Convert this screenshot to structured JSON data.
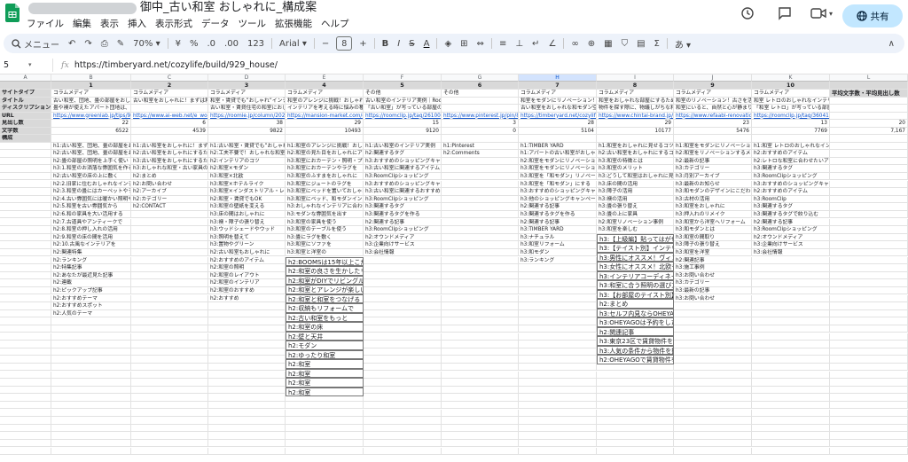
{
  "app": {
    "doc_title": "御中_古い和室 おしゃれに_構成案",
    "share_label": "共有",
    "colors": {
      "accent": "#0b57d0",
      "sheets_green": "#0f9d58",
      "share_bg": "#c2e7ff"
    }
  },
  "menu": [
    "ファイル",
    "編集",
    "表示",
    "挿入",
    "表示形式",
    "データ",
    "ツール",
    "拡張機能",
    "ヘルプ"
  ],
  "toolbar": {
    "search_label": "メニュー",
    "zoom": "70%",
    "currency": "¥",
    "percent": "%",
    "dec_less": ".0",
    "dec_more": ".00",
    "numfmt": "123",
    "font": "Arial",
    "font_size": "8",
    "bold": "B",
    "italic": "I",
    "strike": "S",
    "textcolor": "A",
    "chevron": "∧"
  },
  "formula": {
    "cell_ref": "5",
    "fx": "fx",
    "value": "https://timberyard.net/cozylife/build/929_house/"
  },
  "grid": {
    "columns": [
      "A",
      "B",
      "C",
      "D",
      "E",
      "F",
      "G",
      "H",
      "I",
      "J",
      "K",
      "L"
    ],
    "rows": {
      "site_type": {
        "label": "サイトタイプ",
        "cells": [
          "コラムメディア",
          "コラムメディア",
          "コラムメディア",
          "コラムメディア",
          "その他",
          "その他",
          "コラムメディア",
          "コラムメディア",
          "コラムメディア",
          "コラムメディア",
          "平均文字数・平均見出し数"
        ]
      },
      "title": {
        "label": "タイトル",
        "cells": [
          "古い和室、団地、畳の部屋をおしゃれ",
          "古い和室をおしゃれに！まずは和室の",
          "和室・賃貸でも”おしゃれ”インテリ",
          "和室のアレンジに挑戦！おしゃれに変身",
          "古い和室のインテリア実例｜RoomClip",
          "",
          "和室をモダンにリノベーション！和モダ",
          "和室をおしゃれな部屋にするためのリノ",
          "和室のリノベーション！古さを活かしたデ",
          "和室 レトロのおしゃれなインテリアコ",
          ""
        ]
      },
      "desc": {
        "label": "ディスクリプション",
        "cells": [
          "畳や襖が使えたアパート団地は、実家を",
          "",
          "古い和室・賃貸住宅の和室におしゃれ",
          "インテリアを考える時に悩みの種が和室",
          "「古い和室」が写っている部屋のインテ",
          "",
          "古い和室をおしゃれな和モダン空間へ",
          "物件を探す際に、物議しがちな和室のお",
          "和室にいると、自然と心が静まり安らげ",
          "「和室 レトロ」が写っている部屋のインテ",
          ""
        ]
      },
      "url": {
        "label": "URL",
        "cells": [
          "https://www.greenlab.jp/tips/9298",
          "https://www.ai-web.net/e_woodmaster/",
          "https://roomie.jp/column/2023080",
          "https://mansion-market.com/column/interi",
          "https://roomclip.jp/tag/261004",
          "https://www.pinterest.jp/pin/8577469",
          "https://timberyard.net/cozylife/build/929_h",
          "https://www.chintai-brand.jp/article/",
          "https://www.refaabi-renovation.com/blog",
          "https://roomclip.jp/tag/360415",
          ""
        ]
      },
      "headings": {
        "label": "見出し数",
        "cells": [
          "22",
          "6",
          "38",
          "29",
          "15",
          "3",
          "28",
          "29",
          "23",
          "13",
          "20"
        ]
      },
      "chars": {
        "label": "文字数",
        "cells": [
          "6522",
          "4539",
          "9822",
          "10493",
          "9120",
          "0",
          "5104",
          "10177",
          "5476",
          "7769",
          "7,167"
        ]
      },
      "kousei": {
        "label": "構成",
        "cells": [
          "",
          "",
          "",
          "",
          "",
          "",
          "",
          "",
          "",
          "",
          ""
        ]
      }
    },
    "structure": [
      [
        "h1:古い和室、団地、畳の部屋をおしゃれ",
        "h1:古い和室をおしゃれに！まずは和室の",
        "h1:古い和室・賃貸でも”おしゃれ”インテリ",
        "h1:和室のアレンジに挑戦！おしゃれに変身",
        "h1:古い和室のインテリア実例",
        "h1:Pinterest",
        "h1:TIMBER YARD",
        "h1:和室をおしゃれに見せるコツ！",
        "h1:和室をモダンにリノベーション",
        "h1:和室 レトロのおしゃれなインテリア"
      ],
      [
        "h2:古い和室、団地、畳の部屋をおしゃれ",
        "h2:古い和室をおしゃれにするためのポイ",
        "h2:工夫不要で！おしゃれな和室インテリア",
        "h2:和室の見た目をおしゃれにアレンジ",
        "h2:関連するタグ",
        "h2:Comments",
        "h1:アパートの古い和室がおしゃれに大変身",
        "h2:古い和室をおしゃれにするコツ",
        "h2:和室をリノベーションするメリット",
        "h2:おすすめのアイテム"
      ],
      [
        "h2:畳の部屋の照明を上手く使い",
        "h3:古い和室をおしゃれにするためのポイ",
        "h2:インテリアのコツ",
        "h3:和室におカーテン・照明・プライ",
        "h3:おすすめのショッピングキャンペーン",
        "",
        "h2:和室をモダンにリノベーション",
        "h3:和室の特徴とは",
        "h2:最新の記事",
        "h2:レトロな和室に合わせたいアイテム"
      ],
      [
        "h3:1.和室のお洒落な雰囲気を作る",
        "h3:おしゃれな和室・古い家具の上手な使い",
        "h2:和室×モダン",
        "h3:和室におカーテンやラグを",
        "h3:古い和室に関連するアイテム",
        "",
        "h3:和室をモダンにリノベーション",
        "h3:和室のメリット",
        "h3:カテゴリー",
        "h3:関連するタグ"
      ],
      [
        "h2:古い和室の床の上に敷く",
        "h2:まとめ",
        "h3:和室×北欧",
        "h3:和室のふすまをおしゃれに",
        "h3:RoomClipショッピング",
        "",
        "h3:和室を「和モダン」リノベーション",
        "h3:どうして和室はおしゃれに見えるのか",
        "h3:月別アーカイブ",
        "h3:RoomClipショッピング"
      ],
      [
        "h2:2.旧家に住むおしゃれなインテリア",
        "h2:お問い合わせ",
        "h3:和室×ホテルライク",
        "h3:和室にジュートのラグを",
        "h3:おすすめのショッピングキャンペーン",
        "",
        "h3:和室を「和モダン」にする",
        "h3:床の間の活用",
        "h3:最新のお知らせ",
        "h3:おすすめのショッピングキャンペーン"
      ],
      [
        "h2:3.和室の畳にはカーペットやラグを",
        "h2:アーカイブ",
        "h3:和室×インダストリアル・レトロ",
        "h3:和室にベッドを置いておしゃれ",
        "h3:古い和室に関連するおすすめのアイテム",
        "",
        "h3:おすすめのショッピングキャンペーン",
        "h3:障子の活用",
        "h3:和モダンのデザインにこだわる",
        "h2:おすすめのアイテム"
      ],
      [
        "h2:4.古い雰囲気には暖かい照明や",
        "h2:カテゴリー",
        "h2:和室・賃貸でもOK",
        "h3:和室にベッド、和モダンインテリアの",
        "h3:RoomClipショッピング",
        "",
        "h3:他のショッピングキャンペーン",
        "h3:襖の活用",
        "h3:古材の活用",
        "h3:RoomClip"
      ],
      [
        "h2:5.和室を古い雰囲気から",
        "h2:CONTACT",
        "h3:和室の壁紙を変える",
        "h3:おしゃれなインテリアに合わせた",
        "h3:関連するタグ",
        "",
        "h2:関連する記事",
        "h3:畳の張り替え",
        "h3:和室をおしゃれに",
        "h3:関連するタグ"
      ],
      [
        "h2:6.和の家具を大い活用する",
        "",
        "h3:床の間はおしゃれに",
        "h3:モダンな雰囲気を出す",
        "h3:関連するタグを作る",
        "",
        "h3:関連するタグを作る",
        "h3:畳の上に家具",
        "h3:押入れのリメイク",
        "h3:関連するタグで絞り込む"
      ],
      [
        "h2:7.古道具やアンティークで",
        "",
        "h3:襖・障子の張り替え",
        "h3:和室の家具を使う",
        "h2:関連する記事",
        "",
        "h2:関連する記事",
        "h2:和室リノベーション事例",
        "h3:和室から洋室へリフォーム",
        "h2:関連する記事"
      ],
      [
        "h2:8.和室の押し入れの活用",
        "",
        "h3:ウッドシェードやウッド",
        "h3:和室のテーブルを使う",
        "h3:RoomClipショッピング",
        "",
        "h3:TIMBER YARD",
        "h3:和室を楽しむ",
        "h3:和モダンとは",
        "h3:RoomClipショッピング"
      ],
      [
        "h2:9.和室の床の間を活用",
        "",
        "h3:照明を替えて",
        "h3:畳にラグを敷く",
        "h2:オウンドメディア",
        "",
        "h3:ナチュラル",
        "h3:和モダンの家具",
        "h3:和室の間取り",
        "h2:オウンドメディア"
      ],
      [
        "h2:10.古風なインテリアを",
        "",
        "h3:置物やグリーン",
        "h3:和室にソファを",
        "h3:企業向けサービス",
        "",
        "h3:和室リフォーム",
        "h3:和モダン",
        "h3:障子の張り替え",
        "h3:企業向けサービス"
      ],
      [
        "h2:関連特集",
        "",
        "h2:古い和室もおしゃれに",
        "h3:和室と洋室の",
        "h3:会社情報",
        "",
        "h3:和モダン",
        "h3:和室のアイテム",
        "h3:和室を洋室",
        "h3:会社情報"
      ],
      [
        "h2:ランキング",
        "",
        "h2:おすすめのアイテム",
        "h3:畳の上に",
        "",
        "",
        "h3:ランキング",
        "h3:畳の上の",
        "h2:関連記事",
        ""
      ],
      [
        "h2:特集記事",
        "",
        "h2:和室の照明",
        "h3:おしゃれな和室",
        "",
        "",
        "",
        "h3:和室リフォーム",
        "h3:施工事例",
        ""
      ],
      [
        "h2:あなたが最近見た記事",
        "",
        "h2:和室のレイアウト",
        "h3:和モダンの",
        "",
        "",
        "",
        "h3:和室の",
        "h3:お問い合わせ",
        ""
      ],
      [
        "h2:連載",
        "",
        "h2:和室のインテリア",
        "h3:和室の壁",
        "",
        "",
        "",
        "h3:和室の",
        "h3:カテゴリー",
        ""
      ],
      [
        "h2:ピックアップ記事",
        "",
        "h2:和室のおすすめ",
        "h3:和室の家具",
        "",
        "",
        "",
        "h3:和室の",
        "h3:最新の記事",
        ""
      ],
      [
        "h2:おすすめテーマ",
        "",
        "h2:おすすめ",
        "h3:和室",
        "",
        "",
        "",
        "h3:和室",
        "h3:お問い合わせ",
        ""
      ],
      [
        "h2:おすすめスポット",
        "",
        "",
        "h3:和室",
        "",
        "",
        "",
        "h3:和室",
        "",
        ""
      ],
      [
        "h2:人気のテーマ",
        "",
        "",
        "h3:和室",
        "",
        "",
        "",
        "h3:和室",
        "",
        ""
      ]
    ],
    "boxes": [
      {
        "col": 7,
        "lines": [
          "h3:【上級編】貼ってはがせるリ",
          "h3:【テイスト別】インテリアコ",
          "h3:男性にオススメ！ヴィンテ",
          "h3:女性にオススメ！北欧テイス",
          "h3:インテリアコーディネーター",
          "h3:和室に合う照明の選び方",
          "h3:【お部屋のテイスト別】オス",
          "h2:まとめ",
          "h3:セルフ内見ならOHEYAGOに",
          "h3:OHEYAGOは予約をしたその日",
          "h2:関連記事",
          "h3:東京23区で賃貸物件を探す",
          "h3:人気の条件から物件を探す",
          "h2:OHEYAGOで賃貸物件を探すなら"
        ]
      },
      {
        "col": 3,
        "lines": [
          "h2:BOOMSは15年以上こだわり",
          "h2:和室の良さを生かしたリビン",
          "h2:和室がDIYでリビングルームと",
          "h2:和室とアレンジが楽しい",
          "h2:和室と和室をつなげる",
          "h2:収納もリフォームで",
          "h2:古い和室をもっと",
          "h2:和室の床",
          "h2:壁と天井",
          "h2:モダン",
          "h2:ゆったり和室",
          "h2:和室",
          "h2:和室",
          "h2:和室",
          "h2:和室"
        ]
      }
    ]
  }
}
